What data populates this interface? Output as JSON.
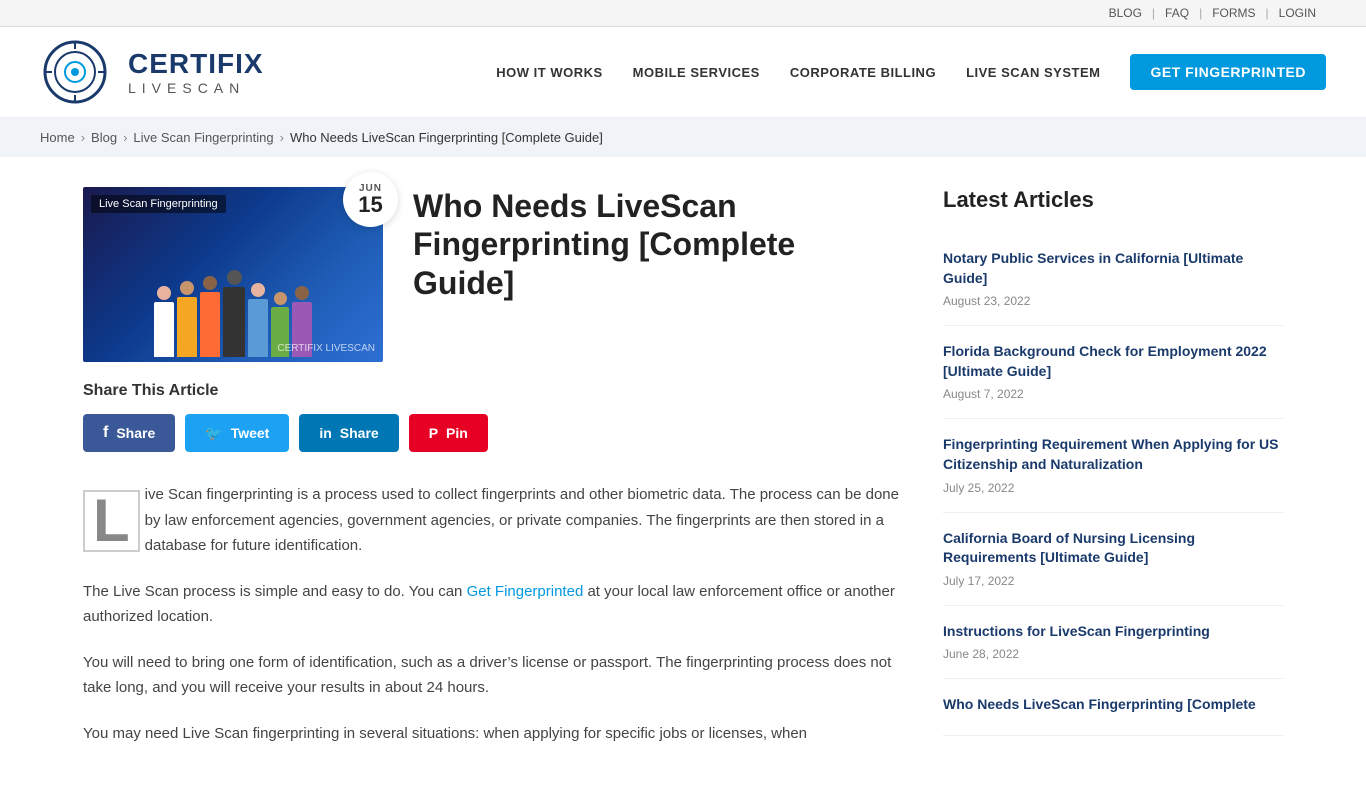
{
  "topbar": {
    "links": [
      {
        "label": "BLOG",
        "href": "#"
      },
      {
        "label": "FAQ",
        "href": "#"
      },
      {
        "label": "FORMS",
        "href": "#"
      },
      {
        "label": "LOGIN",
        "href": "#"
      }
    ]
  },
  "header": {
    "logo": {
      "brand": "CERTIFIX",
      "sub": "LIVESCAN"
    },
    "nav": [
      {
        "label": "HOW IT WORKS",
        "href": "#"
      },
      {
        "label": "MOBILE SERVICES",
        "href": "#"
      },
      {
        "label": "CORPORATE BILLING",
        "href": "#"
      },
      {
        "label": "LIVE SCAN SYSTEM",
        "href": "#"
      }
    ],
    "cta": "GET FINGERPRINTED"
  },
  "breadcrumb": {
    "items": [
      {
        "label": "Home",
        "href": "#"
      },
      {
        "label": "Blog",
        "href": "#"
      },
      {
        "label": "Live Scan Fingerprinting",
        "href": "#"
      },
      {
        "label": "Who Needs LiveScan Fingerprinting [Complete Guide]",
        "href": "#"
      }
    ]
  },
  "article": {
    "image_label": "Live Scan Fingerprinting",
    "image_logo": "CERTIFIX LIVESCAN",
    "date_month": "JUN",
    "date_day": "15",
    "title": "Who Needs LiveScan Fingerprinting [Complete Guide]",
    "share_label": "Share This Article",
    "social": [
      {
        "label": "Share",
        "type": "facebook"
      },
      {
        "label": "Tweet",
        "type": "twitter"
      },
      {
        "label": "Share",
        "type": "linkedin"
      },
      {
        "label": "Pin",
        "type": "pinterest"
      }
    ],
    "body_p1": "ive Scan fingerprinting is a process used to collect fingerprints and other biometric data. The process can be done by law enforcement agencies, government agencies, or private companies. The fingerprints are then stored in a database for future identification.",
    "body_p2_before_link": "The Live Scan process is simple and easy to do. You can ",
    "body_p2_link": "Get Fingerprinted",
    "body_p2_after": " at your local law enforcement office or another authorized location.",
    "body_p3": "You will need to bring one form of identification, such as a driver’s license or passport. The fingerprinting process does not take long, and you will receive your results in about 24 hours.",
    "body_p4": "You may need Live Scan fingerprinting in several situations: when applying for specific jobs or licenses, when"
  },
  "sidebar": {
    "title": "Latest Articles",
    "articles": [
      {
        "title": "Notary Public Services in California [Ultimate Guide]",
        "date": "August 23, 2022"
      },
      {
        "title": "Florida Background Check for Employment 2022 [Ultimate Guide]",
        "date": "August 7, 2022"
      },
      {
        "title": "Fingerprinting Requirement When Applying for US Citizenship and Naturalization",
        "date": "July 25, 2022"
      },
      {
        "title": "California Board of Nursing Licensing Requirements [Ultimate Guide]",
        "date": "July 17, 2022"
      },
      {
        "title": "Instructions for LiveScan Fingerprinting",
        "date": "June 28, 2022"
      },
      {
        "title": "Who Needs LiveScan Fingerprinting [Complete",
        "date": ""
      }
    ]
  }
}
